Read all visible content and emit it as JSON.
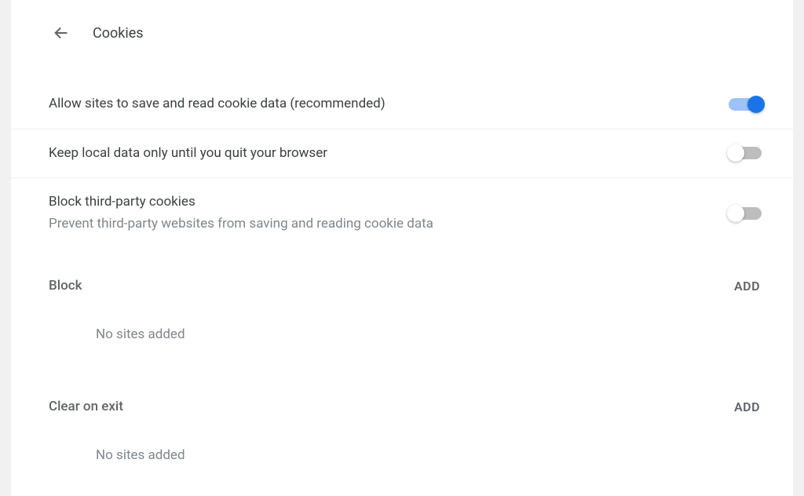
{
  "header": {
    "title": "Cookies"
  },
  "toggles": [
    {
      "label": "Allow sites to save and read cookie data (recommended)",
      "sub": "",
      "on": true
    },
    {
      "label": "Keep local data only until you quit your browser",
      "sub": "",
      "on": false
    },
    {
      "label": "Block third-party cookies",
      "sub": "Prevent third-party websites from saving and reading cookie data",
      "on": false
    }
  ],
  "sections": [
    {
      "title": "Block",
      "add": "ADD",
      "empty": "No sites added"
    },
    {
      "title": "Clear on exit",
      "add": "ADD",
      "empty": "No sites added"
    }
  ]
}
